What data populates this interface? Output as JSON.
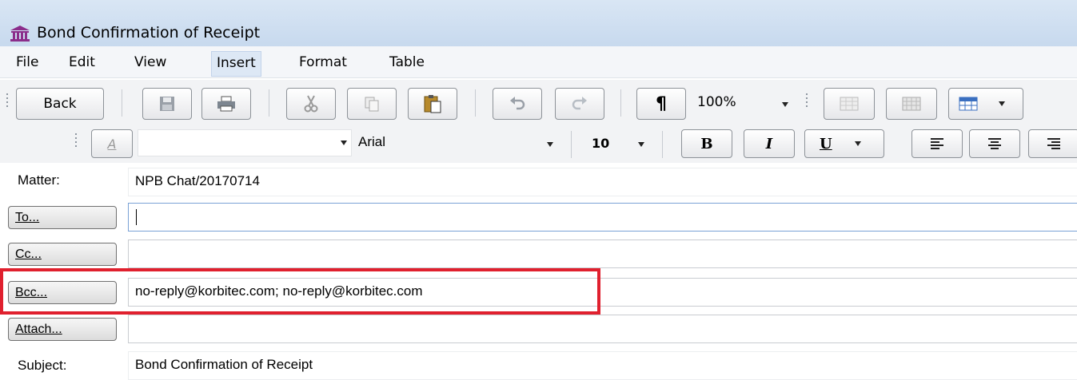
{
  "window": {
    "title": "Bond Confirmation of Receipt",
    "icon": "institution-icon"
  },
  "menu": {
    "items": [
      {
        "label": "File"
      },
      {
        "label": "Edit"
      },
      {
        "label": "View"
      },
      {
        "label": "Insert",
        "active": true
      },
      {
        "label": "Format"
      },
      {
        "label": "Table"
      }
    ]
  },
  "toolbar": {
    "back_label": "Back",
    "pilcrow": "¶",
    "zoom": "100%",
    "font_name": "Arial",
    "font_size": "10",
    "bold": "B",
    "italic": "I",
    "underline": "U"
  },
  "form": {
    "matter_label": "Matter:",
    "matter_value": "NPB Chat/20170714",
    "to_button": "To...",
    "to_value": "",
    "cc_button": "Cc...",
    "cc_value": "",
    "bcc_button": "Bcc...",
    "bcc_value": "no-reply@korbitec.com; no-reply@korbitec.com",
    "attach_button": "Attach...",
    "attach_value": "",
    "subject_label": "Subject:",
    "subject_value": "Bond Confirmation of Receipt"
  },
  "colors": {
    "highlight": "#e0202e",
    "titlebar": "#c7d9ee",
    "icon": "#8b2d8b"
  }
}
